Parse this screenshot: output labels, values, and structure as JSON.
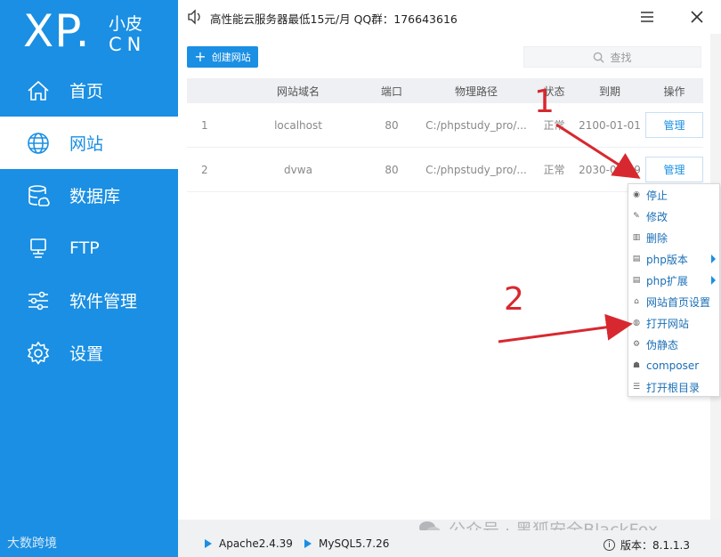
{
  "logo": {
    "main": "XP.",
    "cn_top": "小皮",
    "cn_bottom": "CN"
  },
  "sidebar": {
    "items": [
      {
        "label": "首页",
        "icon": "home-icon"
      },
      {
        "label": "网站",
        "icon": "globe-icon",
        "active": true
      },
      {
        "label": "数据库",
        "icon": "database-icon"
      },
      {
        "label": "FTP",
        "icon": "computer-icon"
      },
      {
        "label": "软件管理",
        "icon": "sliders-icon"
      },
      {
        "label": "设置",
        "icon": "gear-icon"
      }
    ],
    "bottom_brand": "大数跨境"
  },
  "topbar": {
    "notice": "高性能云服务器最低15元/月  QQ群：176643616"
  },
  "toolbar": {
    "create_label": "创建网站",
    "search_placeholder": "查找"
  },
  "table": {
    "headers": [
      "网站域名",
      "端口",
      "物理路径",
      "状态",
      "到期",
      "操作"
    ],
    "rows": [
      {
        "id": "1",
        "domain": "localhost",
        "port": "80",
        "path": "C:/phpstudy_pro/...",
        "status": "正常",
        "expire": "2100-01-01",
        "action": "管理"
      },
      {
        "id": "2",
        "domain": "dvwa",
        "port": "80",
        "path": "C:/phpstudy_pro/...",
        "status": "正常",
        "expire": "2030-02-19",
        "action": "管理"
      }
    ]
  },
  "dropdown": {
    "items": [
      {
        "label": "停止",
        "icon": "stop-icon"
      },
      {
        "label": "修改",
        "icon": "edit-icon"
      },
      {
        "label": "删除",
        "icon": "trash-icon"
      },
      {
        "label": "php版本",
        "icon": "php-version-icon",
        "submenu": true
      },
      {
        "label": "php扩展",
        "icon": "php-extension-icon",
        "submenu": true
      },
      {
        "label": "网站首页设置",
        "icon": "home-small-icon"
      },
      {
        "label": "打开网站",
        "icon": "globe-small-icon"
      },
      {
        "label": "伪静态",
        "icon": "rewrite-icon"
      },
      {
        "label": "composer",
        "icon": "composer-icon"
      },
      {
        "label": "打开根目录",
        "icon": "folder-list-icon"
      }
    ]
  },
  "annotations": {
    "one": "1",
    "two": "2"
  },
  "status": {
    "apache": "Apache2.4.39",
    "mysql": "MySQL5.7.26",
    "version": "版本：8.1.1.3"
  },
  "watermark": "公众号 · 黑狐安全BlackFox",
  "colors": {
    "accent": "#1a8fe3",
    "annotation": "#d8282f"
  }
}
